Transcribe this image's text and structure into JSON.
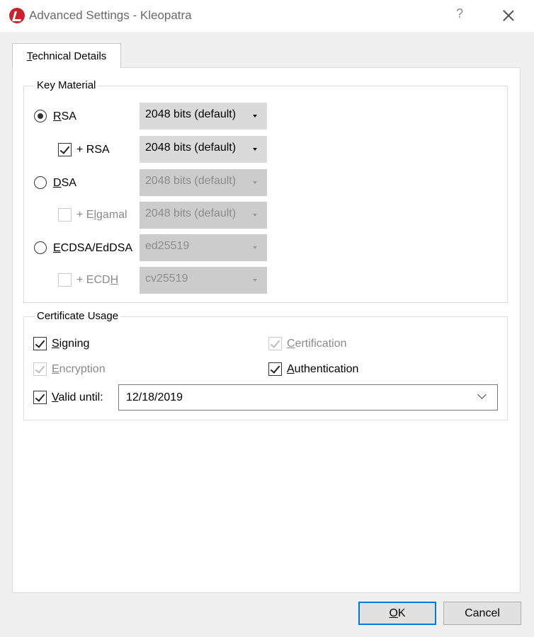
{
  "window": {
    "title": "Advanced Settings - Kleopatra",
    "help_glyph": "?"
  },
  "tabs": [
    {
      "label": "Technical Details",
      "mnemonic_prefix": "",
      "mnemonic": "T",
      "suffix": "echnical Details"
    }
  ],
  "key_material": {
    "legend": "Key Material",
    "rows": [
      {
        "kind": "radio",
        "checked": true,
        "enabled": true,
        "label_pre": "",
        "mnemonic": "R",
        "label_post": "SA",
        "combo": "2048 bits (default)"
      },
      {
        "kind": "checkbox",
        "checked": true,
        "enabled": true,
        "label_pre": "+ RSA",
        "mnemonic": "",
        "label_post": "",
        "combo": "2048 bits (default)"
      },
      {
        "kind": "radio",
        "checked": false,
        "enabled": true,
        "label_pre": "",
        "mnemonic": "D",
        "label_post": "SA",
        "combo": "2048 bits (default)",
        "combo_enabled": false
      },
      {
        "kind": "checkbox",
        "checked": false,
        "enabled": false,
        "label_pre": "+ E",
        "mnemonic": "l",
        "label_post": "gamal",
        "combo": "2048 bits (default)"
      },
      {
        "kind": "radio",
        "checked": false,
        "enabled": true,
        "label_pre": "",
        "mnemonic": "E",
        "label_post": "CDSA/EdDSA",
        "combo": "ed25519",
        "combo_enabled": false
      },
      {
        "kind": "checkbox",
        "checked": false,
        "enabled": false,
        "label_pre": "+ ECD",
        "mnemonic": "H",
        "label_post": "",
        "combo": "cv25519"
      }
    ]
  },
  "certificate_usage": {
    "legend": "Certificate Usage",
    "signing": {
      "mnemonic": "S",
      "rest": "igning",
      "checked": true,
      "enabled": true
    },
    "certification": {
      "mnemonic": "C",
      "rest": "ertification",
      "checked": true,
      "enabled": false
    },
    "encryption": {
      "mnemonic": "E",
      "rest": "ncryption",
      "checked": true,
      "enabled": false
    },
    "authentication": {
      "mnemonic": "A",
      "rest": "uthentication",
      "checked": true,
      "enabled": true
    },
    "valid_until": {
      "mnemonic": "V",
      "rest": "alid until:",
      "checked": true,
      "enabled": true,
      "date": "12/18/2019"
    }
  },
  "buttons": {
    "ok": {
      "mnemonic": "O",
      "rest": "K"
    },
    "cancel": {
      "label": "Cancel"
    }
  },
  "colors": {
    "accent": "#0078d7",
    "app_icon": "#c8232c"
  }
}
